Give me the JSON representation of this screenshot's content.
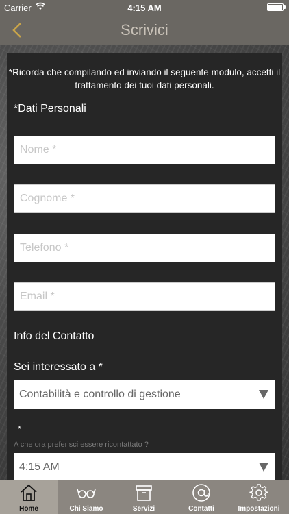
{
  "status_bar": {
    "carrier": "Carrier",
    "time": "4:15 AM"
  },
  "nav": {
    "title": "Scrivici",
    "back_icon": "chevron-left-icon"
  },
  "form": {
    "notice": "*Ricorda che compilando ed inviando il seguente modulo, accetti il trattamento dei tuoi dati personali.",
    "personal_section": "*Dati Personali",
    "name_placeholder": "Nome *",
    "surname_placeholder": "Cognome *",
    "phone_placeholder": "Telefono *",
    "email_placeholder": "Email *",
    "contact_section": "Info del Contatto",
    "interest_label": "Sei interessato a *",
    "interest_value": "Contabilità e controllo di gestione",
    "time_star": "*",
    "time_label": "A che ora preferisci essere ricontattato ?",
    "time_value": "4:15 AM"
  },
  "tabs": [
    {
      "label": "Home",
      "icon": "home-icon",
      "active": true
    },
    {
      "label": "Chi Siamo",
      "icon": "glasses-icon",
      "active": false
    },
    {
      "label": "Servizi",
      "icon": "box-icon",
      "active": false
    },
    {
      "label": "Contatti",
      "icon": "at-sign-icon",
      "active": false
    },
    {
      "label": "Impostazioni",
      "icon": "gear-icon",
      "active": false
    }
  ],
  "colors": {
    "bar": "#6a6762",
    "tabbar": "#8b8680",
    "panel": "#262626",
    "title": "#c9c2b8",
    "back": "#c8a44a"
  }
}
